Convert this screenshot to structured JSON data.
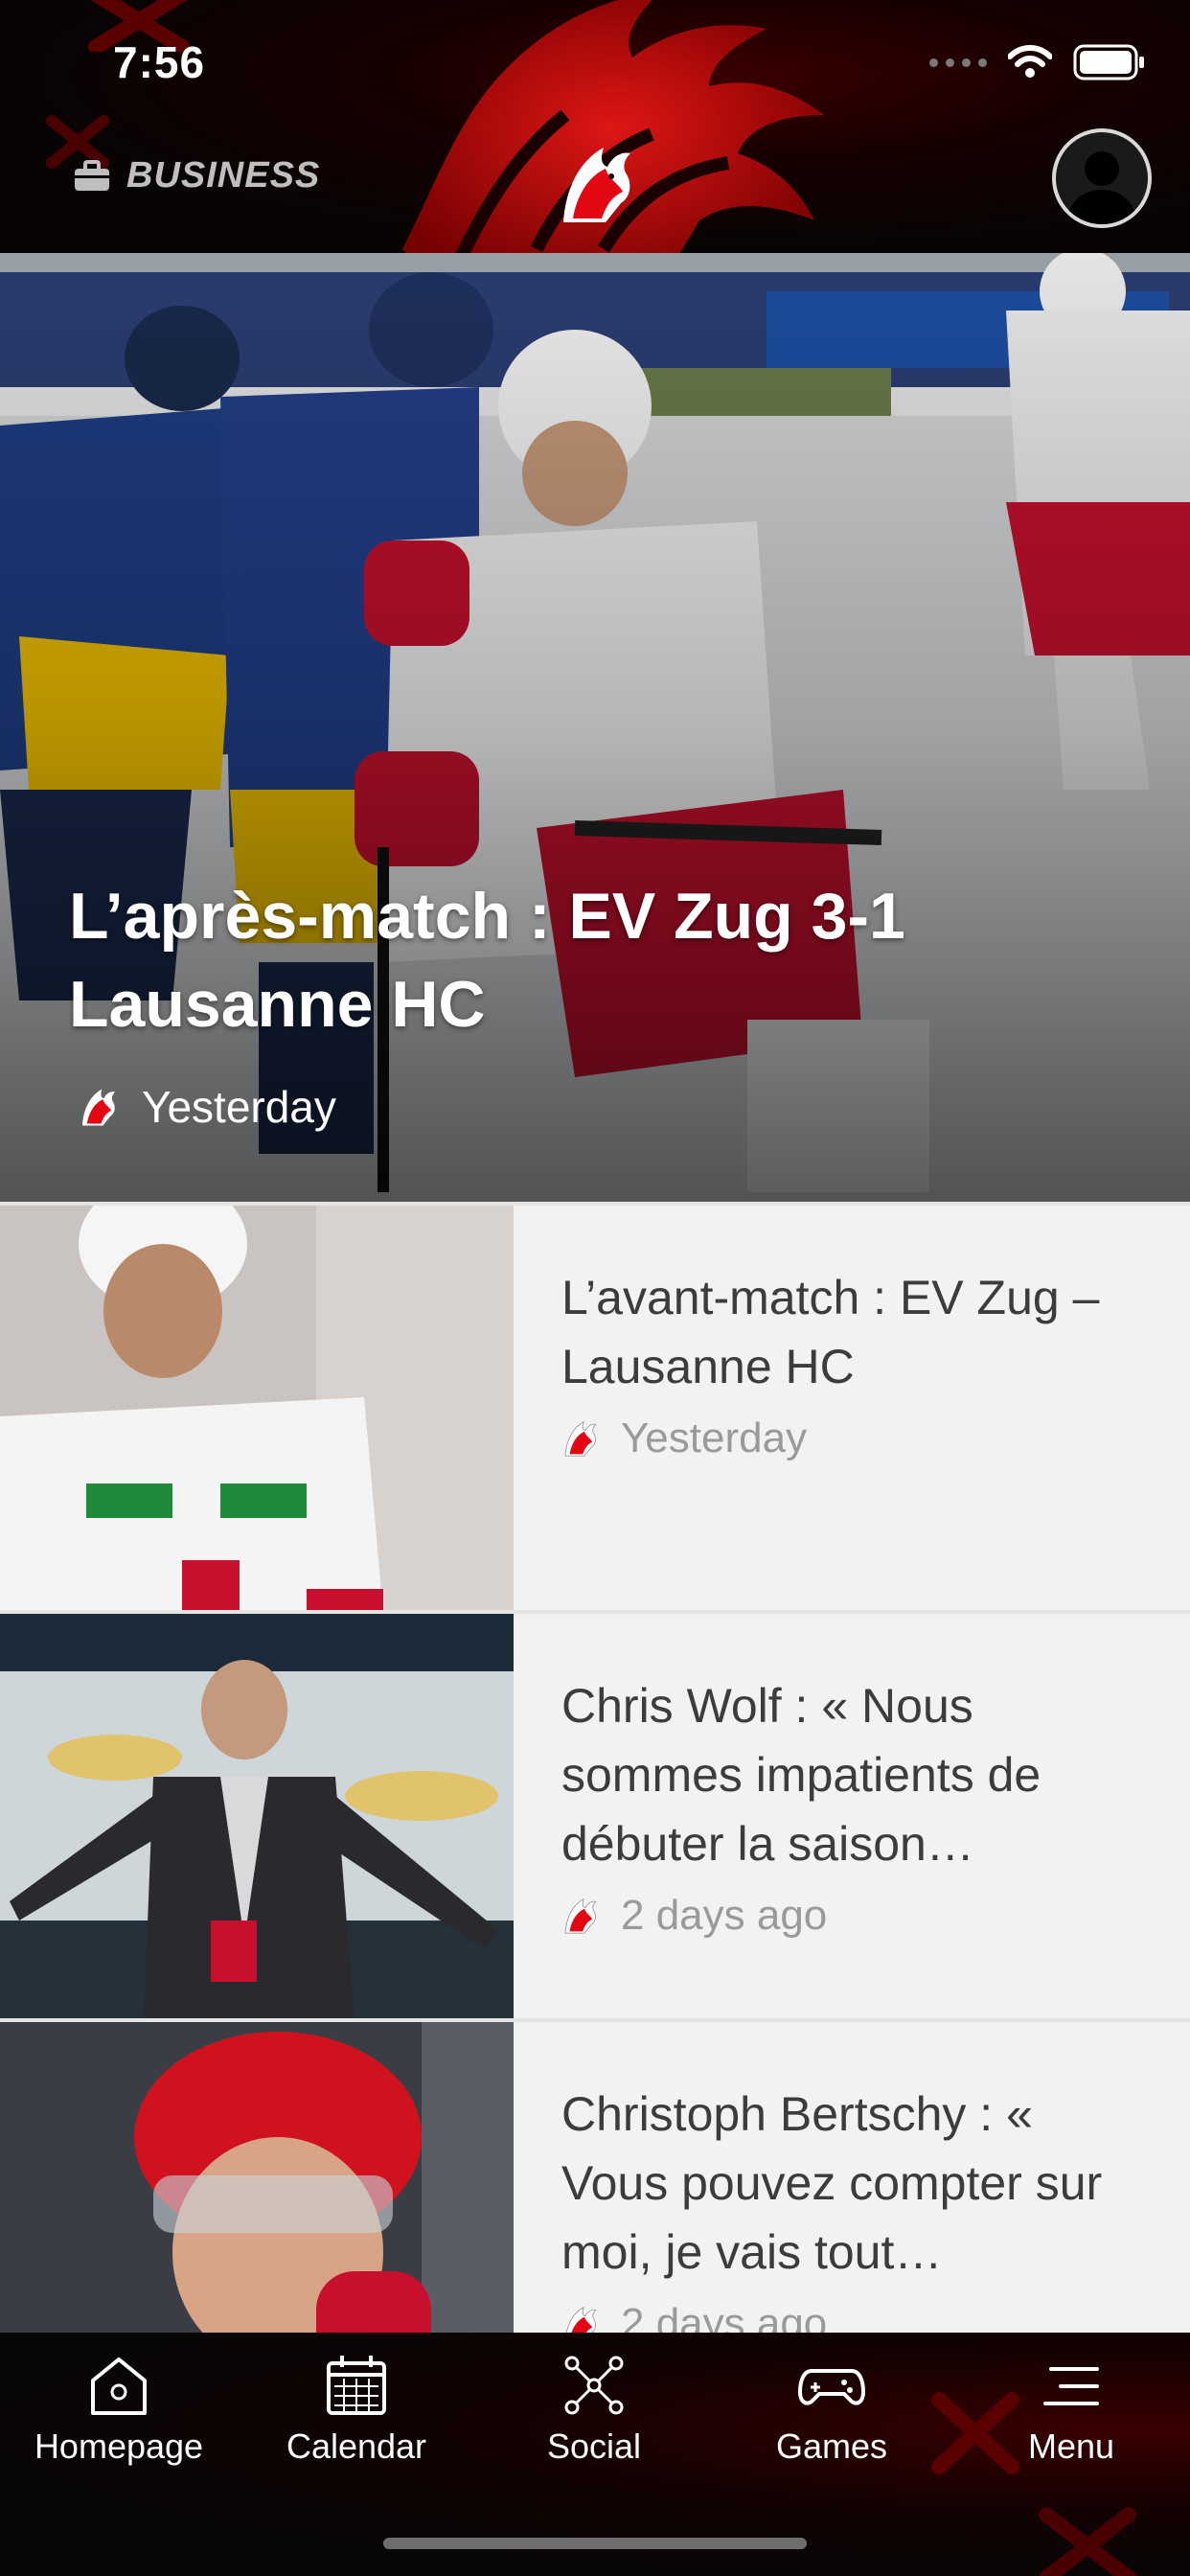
{
  "status_bar": {
    "time": "7:56",
    "icons": [
      "signal-icon",
      "wifi-icon",
      "battery-icon"
    ]
  },
  "header": {
    "business_label": "BUSINESS",
    "business_icon": "briefcase-icon",
    "logo": "lion-logo-icon",
    "profile": "avatar-icon"
  },
  "hero": {
    "title": "L’après-match : EV Zug 3-1 Lausanne HC",
    "date": "Yesterday"
  },
  "articles": [
    {
      "title": "L’avant-match : EV Zug – Lausanne HC",
      "date": "Yesterday"
    },
    {
      "title": "Chris Wolf : « Nous sommes impatients de débuter la saison…",
      "date": "2 days ago"
    },
    {
      "title": "Christoph Bertschy : « Vous pouvez compter sur moi, je vais tout…",
      "date": "2 days ago"
    }
  ],
  "tabbar": {
    "items": [
      {
        "label": "Homepage",
        "icon": "home-icon"
      },
      {
        "label": "Calendar",
        "icon": "calendar-icon"
      },
      {
        "label": "Social",
        "icon": "social-network-icon"
      },
      {
        "label": "Games",
        "icon": "gamepad-icon"
      },
      {
        "label": "Menu",
        "icon": "menu-icon"
      }
    ]
  },
  "colors": {
    "brand_red": "#e30613",
    "header_bg": "#0a0404",
    "list_bg": "#f2f2f2",
    "title_text": "#3c3c3c",
    "meta_text": "#9a9a9a"
  }
}
